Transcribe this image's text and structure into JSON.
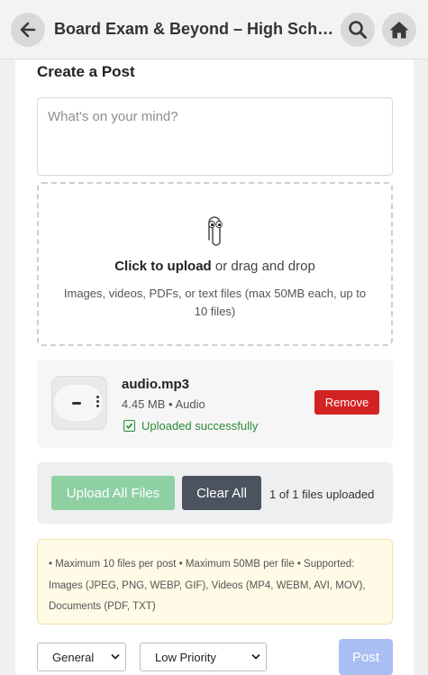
{
  "header": {
    "title": "Board Exam & Beyond – High School Stude…",
    "back_icon": "arrow-left-icon",
    "search_icon": "search-icon",
    "home_icon": "home-icon"
  },
  "composer": {
    "heading": "Create a Post",
    "placeholder": "What's on your mind?",
    "dropzone": {
      "icon": "paperclip-icon",
      "click_label": "Click to upload",
      "drag_label": "or drag and drop",
      "hint": "Images, videos, PDFs, or text files (max 50MB each, up to 10 files)"
    },
    "file": {
      "name": "audio.mp3",
      "meta": "4.45 MB • Audio",
      "status": "Uploaded successfully",
      "remove_label": "Remove"
    },
    "actions": {
      "upload_all_label": "Upload All Files",
      "clear_all_label": "Clear All",
      "progress_text": "1 of 1 files uploaded"
    },
    "notice": "• Maximum 10 files per post • Maximum 50MB per file • Supported: Images (JPEG, PNG, WEBP, GIF), Videos (MP4, WEBM, AVI, MOV), Documents (PDF, TXT)",
    "category": "General",
    "priority": "Low Priority",
    "post_label": "Post"
  },
  "colors": {
    "remove": "#d32222",
    "upload": "#8fd0a3",
    "clear": "#4a535e",
    "post": "#a9bff2",
    "success": "#2e8b3a"
  }
}
